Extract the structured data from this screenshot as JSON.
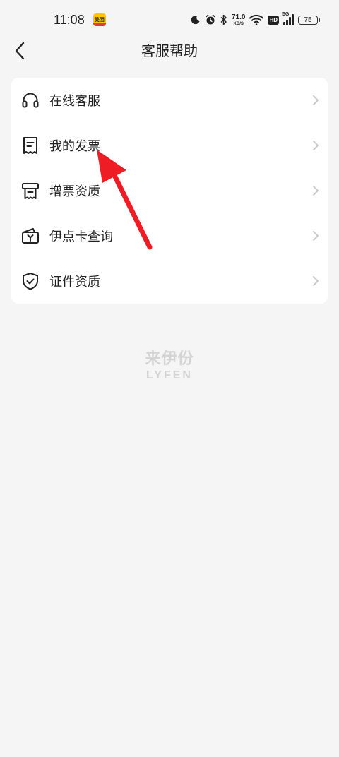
{
  "status_bar": {
    "time": "11:08",
    "app_badge": "美团",
    "net_speed_value": "71.0",
    "net_speed_unit": "KB/S",
    "hd_label": "HD",
    "network_type": "5G",
    "battery": "75"
  },
  "header": {
    "title": "客服帮助"
  },
  "menu": {
    "items": [
      {
        "label": "在线客服",
        "icon": "headset-icon"
      },
      {
        "label": "我的发票",
        "icon": "invoice-icon"
      },
      {
        "label": "增票资质",
        "icon": "receipt-icon"
      },
      {
        "label": "伊点卡查询",
        "icon": "card-icon"
      },
      {
        "label": "证件资质",
        "icon": "shield-check-icon"
      }
    ]
  },
  "brand": {
    "name_cn": "来伊份",
    "name_en": "LYFEN"
  },
  "colors": {
    "background": "#f5f5f5",
    "card": "#ffffff",
    "text": "#222222",
    "chevron": "#c4c4c4",
    "watermark": "#d4d4d4",
    "annotation": "#ee1c24"
  }
}
